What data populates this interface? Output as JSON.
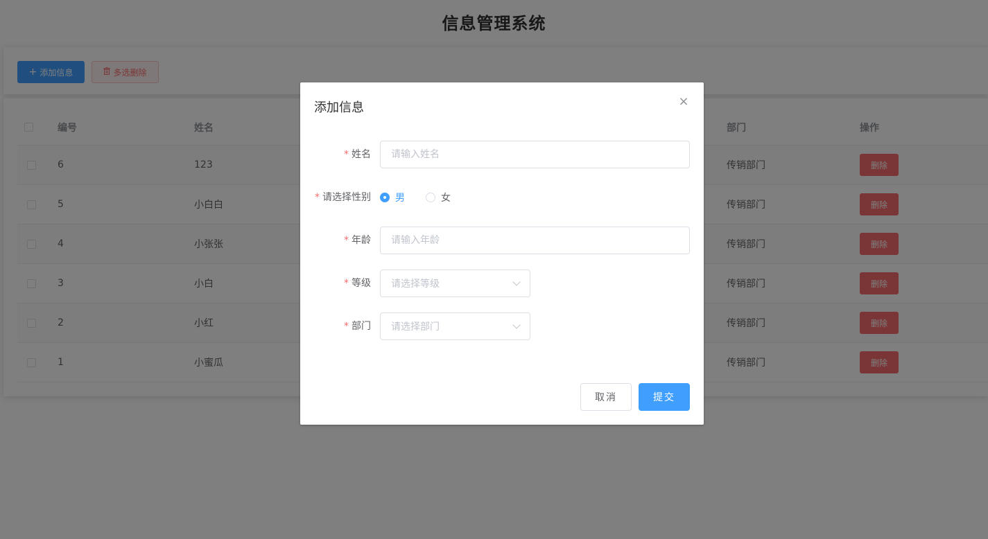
{
  "page": {
    "title": "信息管理系统"
  },
  "toolbar": {
    "add_label": "添加信息",
    "multi_delete_label": "多选删除"
  },
  "table": {
    "headers": {
      "id": "编号",
      "name": "姓名",
      "dept": "部门",
      "action": "操作"
    },
    "rows": [
      {
        "id": "6",
        "name": "123",
        "dept": "传销部门",
        "action": "删除"
      },
      {
        "id": "5",
        "name": "小白白",
        "dept": "传销部门",
        "action": "删除"
      },
      {
        "id": "4",
        "name": "小张张",
        "dept": "传销部门",
        "action": "删除"
      },
      {
        "id": "3",
        "name": "小白",
        "dept": "传销部门",
        "action": "删除"
      },
      {
        "id": "2",
        "name": "小红",
        "dept": "传销部门",
        "action": "删除"
      },
      {
        "id": "1",
        "name": "小蜜瓜",
        "dept": "传销部门",
        "action": "删除"
      }
    ]
  },
  "dialog": {
    "title": "添加信息",
    "close_icon": "×",
    "fields": {
      "name": {
        "label": "姓名",
        "placeholder": "请输入姓名",
        "value": ""
      },
      "gender": {
        "label": "请选择性别",
        "options": [
          "男",
          "女"
        ],
        "selected": "男"
      },
      "age": {
        "label": "年龄",
        "placeholder": "请输入年龄",
        "value": ""
      },
      "level": {
        "label": "等级",
        "placeholder": "请选择等级"
      },
      "dept": {
        "label": "部门",
        "placeholder": "请选择部门"
      }
    },
    "required_mark": "*",
    "cancel_label": "取消",
    "submit_label": "提交"
  },
  "icons": {
    "add": "plus-icon",
    "multi_delete": "trash-icon",
    "close": "close-icon",
    "select": "chevron-down-icon"
  },
  "colors": {
    "primary": "#409eff",
    "danger": "#f56c6c",
    "mask": "rgba(0,0,0,0.5)"
  }
}
